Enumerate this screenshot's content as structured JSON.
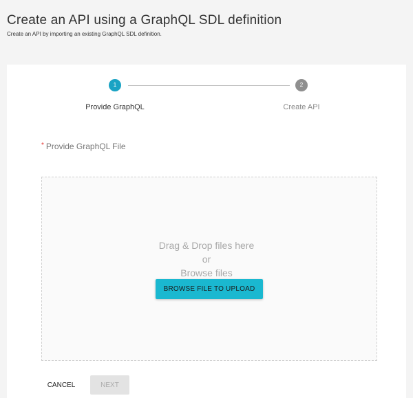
{
  "header": {
    "title": "Create an API using a GraphQL SDL definition",
    "subtitle": "Create an API by importing an existing GraphQL SDL definition."
  },
  "stepper": {
    "steps": [
      {
        "number": "1",
        "label": "Provide GraphQL",
        "state": "active"
      },
      {
        "number": "2",
        "label": "Create API",
        "state": "inactive"
      }
    ]
  },
  "form": {
    "required_marker": "*",
    "file_label": "Provide GraphQL File"
  },
  "dropzone": {
    "line1": "Drag & Drop files here",
    "line2": "or",
    "line3": "Browse files",
    "browse_button": "BROWSE FILE TO UPLOAD"
  },
  "actions": {
    "cancel": "CANCEL",
    "next": "NEXT"
  },
  "colors": {
    "accent": "#1aa3c4",
    "required": "#e53935",
    "inactive_step": "#8f8f8f"
  }
}
